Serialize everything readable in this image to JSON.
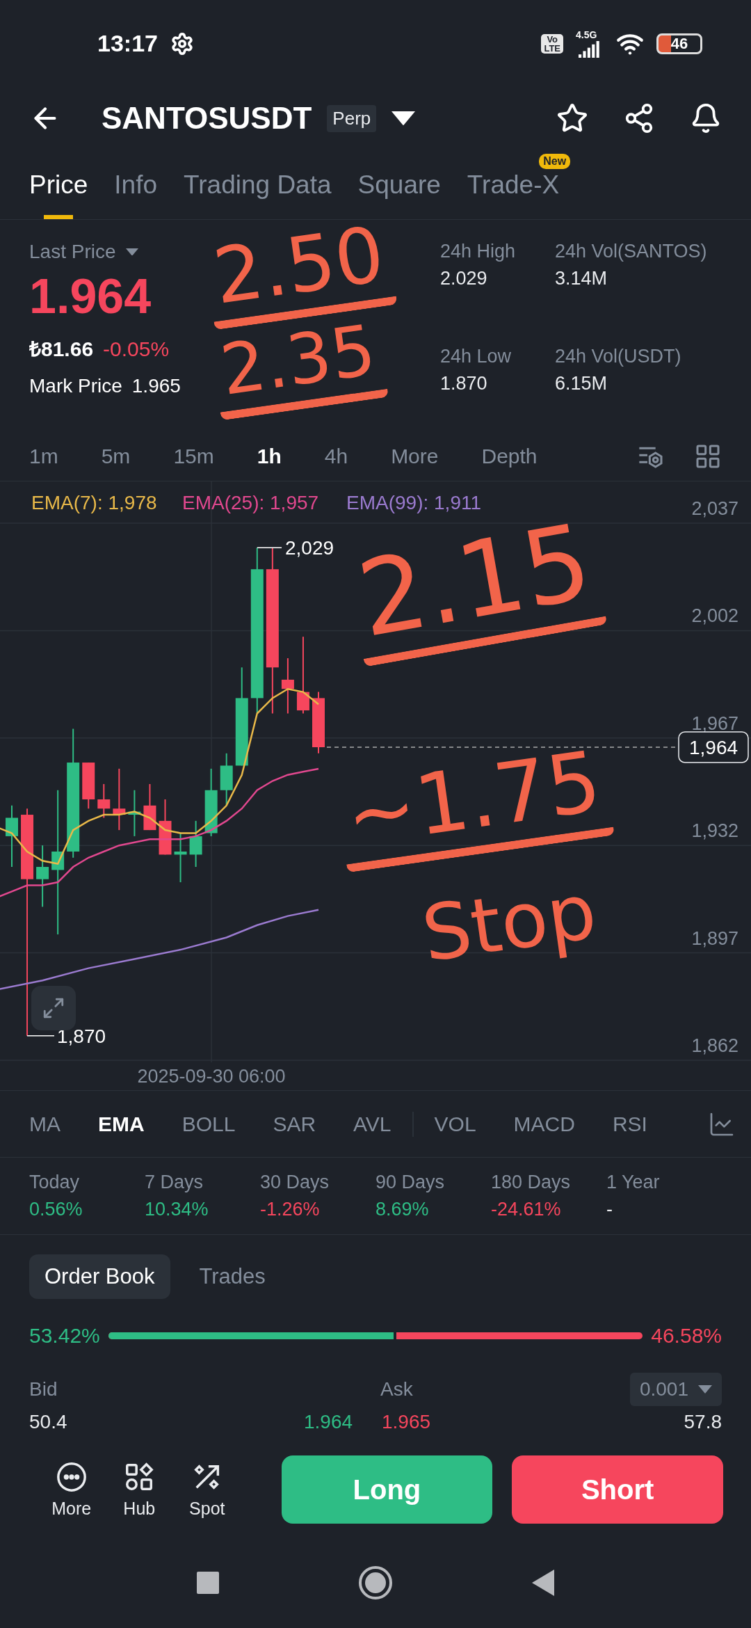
{
  "status_bar": {
    "time": "13:17",
    "volte_top": "Vo",
    "volte_bottom": "LTE",
    "network": "4.5G",
    "battery": "46"
  },
  "header": {
    "symbol": "SANTOSUSDT",
    "badge": "Perp"
  },
  "tabs": [
    {
      "label": "Price",
      "selected": true
    },
    {
      "label": "Info",
      "selected": false
    },
    {
      "label": "Trading Data",
      "selected": false
    },
    {
      "label": "Square",
      "selected": false
    },
    {
      "label": "Trade-X",
      "selected": false,
      "badge": "New"
    }
  ],
  "ticker": {
    "label": "Last Price",
    "price": "1.964",
    "fiat": "₺81.66",
    "change": "-0.05%",
    "mark_label": "Mark Price",
    "mark_price": "1.965",
    "stats": [
      {
        "label": "24h High",
        "value": "2.029"
      },
      {
        "label": "24h Vol(SANTOS)",
        "value": "3.14M"
      },
      {
        "label": "24h Low",
        "value": "1.870"
      },
      {
        "label": "24h Vol(USDT)",
        "value": "6.15M"
      }
    ]
  },
  "intervals": [
    {
      "label": "1m",
      "selected": false
    },
    {
      "label": "5m",
      "selected": false
    },
    {
      "label": "15m",
      "selected": false
    },
    {
      "label": "1h",
      "selected": true
    },
    {
      "label": "4h",
      "selected": false
    },
    {
      "label": "More",
      "selected": false
    },
    {
      "label": "Depth",
      "selected": false
    }
  ],
  "chart": {
    "legend": [
      {
        "label": "EMA(7): 1,978",
        "color": "#e9b949"
      },
      {
        "label": "EMA(25): 1,957",
        "color": "#e2488f"
      },
      {
        "label": "EMA(99): 1,911",
        "color": "#9b7bd0"
      }
    ],
    "price_axis": [
      "2,037",
      "2,002",
      "1,967",
      "1,932",
      "1,897",
      "1,862"
    ],
    "high_label": "2,029",
    "low_label": "1,870",
    "last_price": "1,964",
    "time_label": "2025-09-30 06:00"
  },
  "indicators": [
    {
      "label": "MA",
      "selected": false
    },
    {
      "label": "EMA",
      "selected": true
    },
    {
      "label": "BOLL",
      "selected": false
    },
    {
      "label": "SAR",
      "selected": false
    },
    {
      "label": "AVL",
      "selected": false
    },
    {
      "label": "VOL",
      "selected": false
    },
    {
      "label": "MACD",
      "selected": false
    },
    {
      "label": "RSI",
      "selected": false
    }
  ],
  "performance": [
    {
      "label": "Today",
      "value": "0.56%",
      "color": "#2ebd85"
    },
    {
      "label": "7 Days",
      "value": "10.34%",
      "color": "#2ebd85"
    },
    {
      "label": "30 Days",
      "value": "-1.26%",
      "color": "#f6465d"
    },
    {
      "label": "90 Days",
      "value": "8.69%",
      "color": "#2ebd85"
    },
    {
      "label": "180 Days",
      "value": "-24.61%",
      "color": "#f6465d"
    },
    {
      "label": "1 Year",
      "value": "-",
      "color": "#eaecef"
    }
  ],
  "order_book": {
    "tabs": [
      {
        "label": "Order Book",
        "selected": true
      },
      {
        "label": "Trades",
        "selected": false
      }
    ],
    "bid_share": "53.42%",
    "ask_share": "46.58%",
    "level": 0.5342,
    "bid_label": "Bid",
    "ask_label": "Ask",
    "precision": "0.001",
    "row": {
      "bid_qty": "50.4",
      "bid_price": "1.964",
      "ask_price": "1.965",
      "ask_qty": "57.8"
    }
  },
  "bottom_bar": {
    "shortcuts": [
      {
        "label": "More",
        "kind": "more"
      },
      {
        "label": "Hub",
        "kind": "hub"
      },
      {
        "label": "Spot",
        "kind": "spot"
      }
    ],
    "long": "Long",
    "short": "Short"
  },
  "annotations": [
    {
      "text": "2.50",
      "underlined": true
    },
    {
      "text": "2.35",
      "underlined": true
    },
    {
      "text": "2.15",
      "underlined": true
    },
    {
      "text": "~1.75",
      "underlined": true
    },
    {
      "text": "Stop",
      "underlined": false
    }
  ]
}
